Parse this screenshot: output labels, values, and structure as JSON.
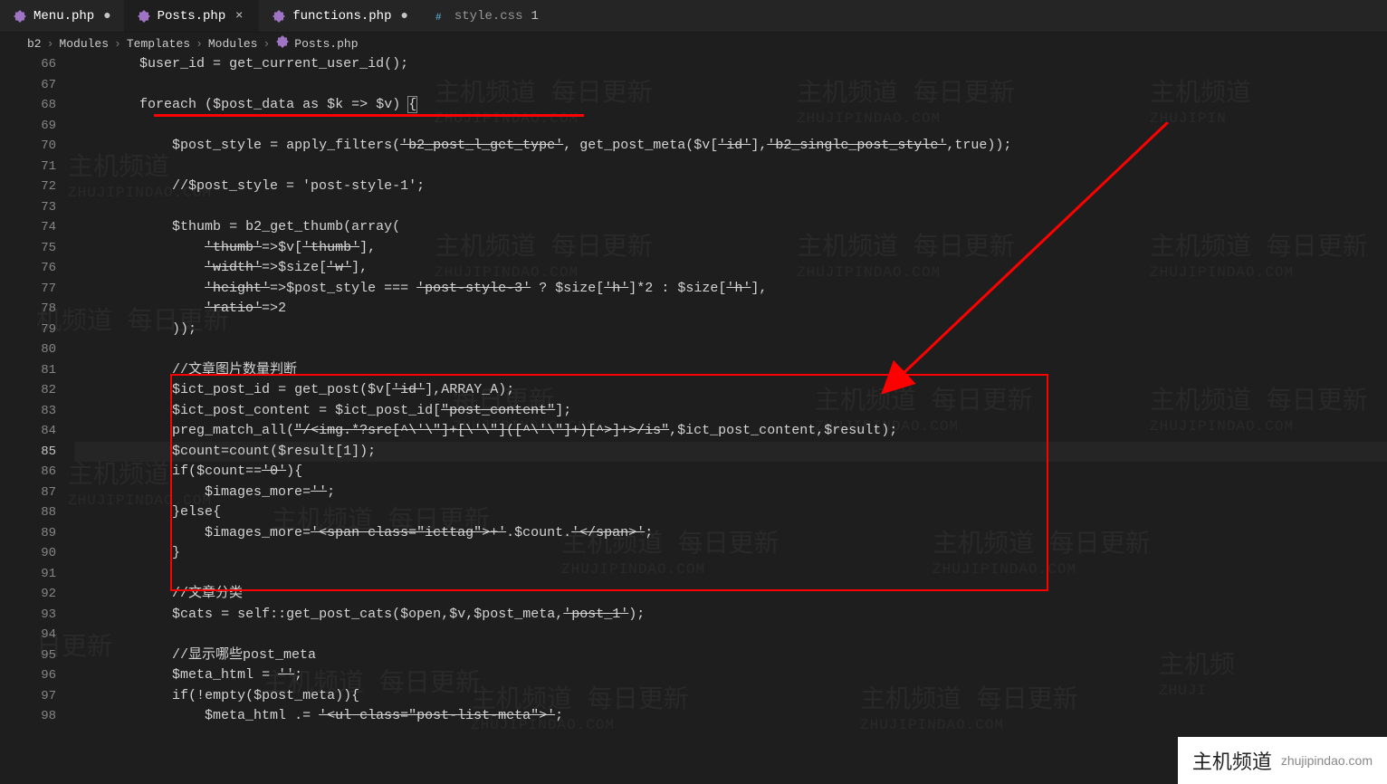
{
  "tabs": [
    {
      "icon": "php",
      "label": "Menu.php",
      "active": false,
      "dirty": true
    },
    {
      "icon": "php",
      "label": "Posts.php",
      "active": true,
      "dirty": false
    },
    {
      "icon": "php",
      "label": "functions.php",
      "active": false,
      "dirty": true
    },
    {
      "icon": "css",
      "label": "style.css",
      "active": false,
      "modified": "1"
    }
  ],
  "breadcrumbs": [
    "b2",
    "Modules",
    "Templates",
    "Modules",
    "Posts.php"
  ],
  "breadcrumb_sep": "›",
  "line_start": 66,
  "line_end": 98,
  "current_line": 85,
  "code_lines": [
    "        <v>$user_id</v> <o>=</o> <f>get_current_user_id</f><o>();</o>",
    "",
    "        <k>foreach</k> <o>(</o><v>$post_data</v> <k>as</k> <v>$k</v> <o>=&gt;</o> <v>$v</v><o>)</o> <o class='bracket-box'>{</o>",
    "",
    "            <v>$post_style</v> <o>=</o> <f>apply_filters</f><o>(</o><s>'b2_post_l_get_type'</s><o>,</o> <f>get_post_meta</f><o>(</o><v>$v</v><o>[</o><s>'id'</s><o>],</o><s>'b2_single_post_style'</s><o>,</o><co>true</co><o>));</o>",
    "",
    "            <c>//$post_style = 'post-style-1';</c>",
    "",
    "            <v>$thumb</v> <o>=</o> <f>b2_get_thumb</f><o>(</o><k>array</k><o>(</o>",
    "                <s>'thumb'</s><o>=&gt;</o><v>$v</v><o>[</o><s>'thumb'</s><o>],</o>",
    "                <s>'width'</s><o>=&gt;</o><v>$size</v><o>[</o><s>'w'</s><o>],</o>",
    "                <s>'height'</s><o>=&gt;</o><v>$post_style</v> <o>===</o> <s>'post-style-3'</s> <o>?</o> <v>$size</v><o>[</o><s>'h'</s><o>]*</o><n>2</n> <o>:</o> <v>$size</v><o>[</o><s>'h'</s><o>],</o>",
    "                <s>'ratio'</s><o>=&gt;</o><n>2</n>",
    "            <o>));</o>",
    "",
    "            <c>//文章图片数量判断</c>",
    "            <v>$ict_post_id</v> <o>=</o> <f>get_post</f><o>(</o><v>$v</v><o>[</o><s>'id'</s><o>],</o><co>ARRAY_A</co><o>);</o>",
    "            <v>$ict_post_content</v> <o>=</o> <v>$ict_post_id</v><o>[</o><s>\"post_content\"</s><o>];</o>",
    "            <f>preg_match_all</f><o>(</o><s>\"/&lt;img.*?src[^\\'\\\"]+[\\'\\\"]([^\\'\\\"]+)[^&gt;]+&gt;/is\"</s><o>,</o><v>$ict_post_content</v><o>,</o><v>$result</v><o>);</o>",
    "            <v>$count</v><o>=</o><f>count</f><o>(</o><v>$result</v><o>[</o><n>1</n><o>]);</o>",
    "            <k>if</k><o>(</o><v>$count</v><o>==</o><s>'0'</s><o>){</o>",
    "                <v>$images_more</v><o>=</o><s>''</s><o>;</o>",
    "            <o>}</o><k>else</k><o>{</o>",
    "                <v>$images_more</v><o>=</o><s>'&lt;span class=\"icttag\"&gt;+'</s><o>.</o><v>$count</v><o>.</o><s>'&lt;/span&gt;'</s><o>;</o>",
    "            <o>}</o>",
    "",
    "            <c>//文章分类</c>",
    "            <v>$cats</v> <o>=</o> <co>self</co><o>::</o><f>get_post_cats</f><o>(</o><v>$open</v><o>,</o><v>$v</v><o>,</o><v>$post_meta</v><o>,</o><s>'post_1'</s><o>);</o>",
    "",
    "            <c>//显示哪些post_meta</c>",
    "            <v>$meta_html</v> <o>=</o> <s>''</s><o>;</o>",
    "            <k>if</k><o>(!</o><f>empty</f><o>(</o><v>$post_meta</v><o>)){</o>",
    "                <v>$meta_html</v> <o>.=</o> <s>'&lt;ul class=\"post-list-meta\"&gt;'</s><o>;</o>"
  ],
  "badge": {
    "main": "主机频道",
    "sub": "zhujipindao.com"
  }
}
